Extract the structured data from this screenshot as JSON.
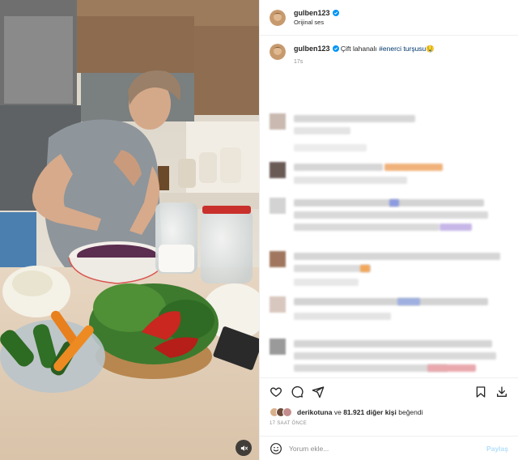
{
  "post": {
    "username": "gulben123",
    "audio": "Orijinal ses",
    "caption_text": "Çift lahanalı",
    "caption_tag": "#enerci turşusu",
    "caption_emoji": "🤤",
    "caption_time": "17s"
  },
  "likes": {
    "liked_by": "derikotuna",
    "connector": "ve",
    "others": "81.921 diğer kişi",
    "suffix": "beğendi"
  },
  "timestamp": "17 SAAT ÖNCE",
  "comment_input": {
    "placeholder": "Yorum ekle...",
    "post_label": "Paylaş"
  },
  "icons": {
    "like": "heart-icon",
    "comment": "comment-icon",
    "share": "paper-plane-icon",
    "save": "bookmark-icon",
    "download": "download-icon",
    "emoji": "smiley-icon",
    "mute": "speaker-muted-icon",
    "verified": "verified-badge-icon"
  },
  "colors": {
    "accent": "#0095f6",
    "post_disabled": "#b2dffc",
    "hashtag": "#00376b",
    "muted_text": "#8e8e8e"
  }
}
